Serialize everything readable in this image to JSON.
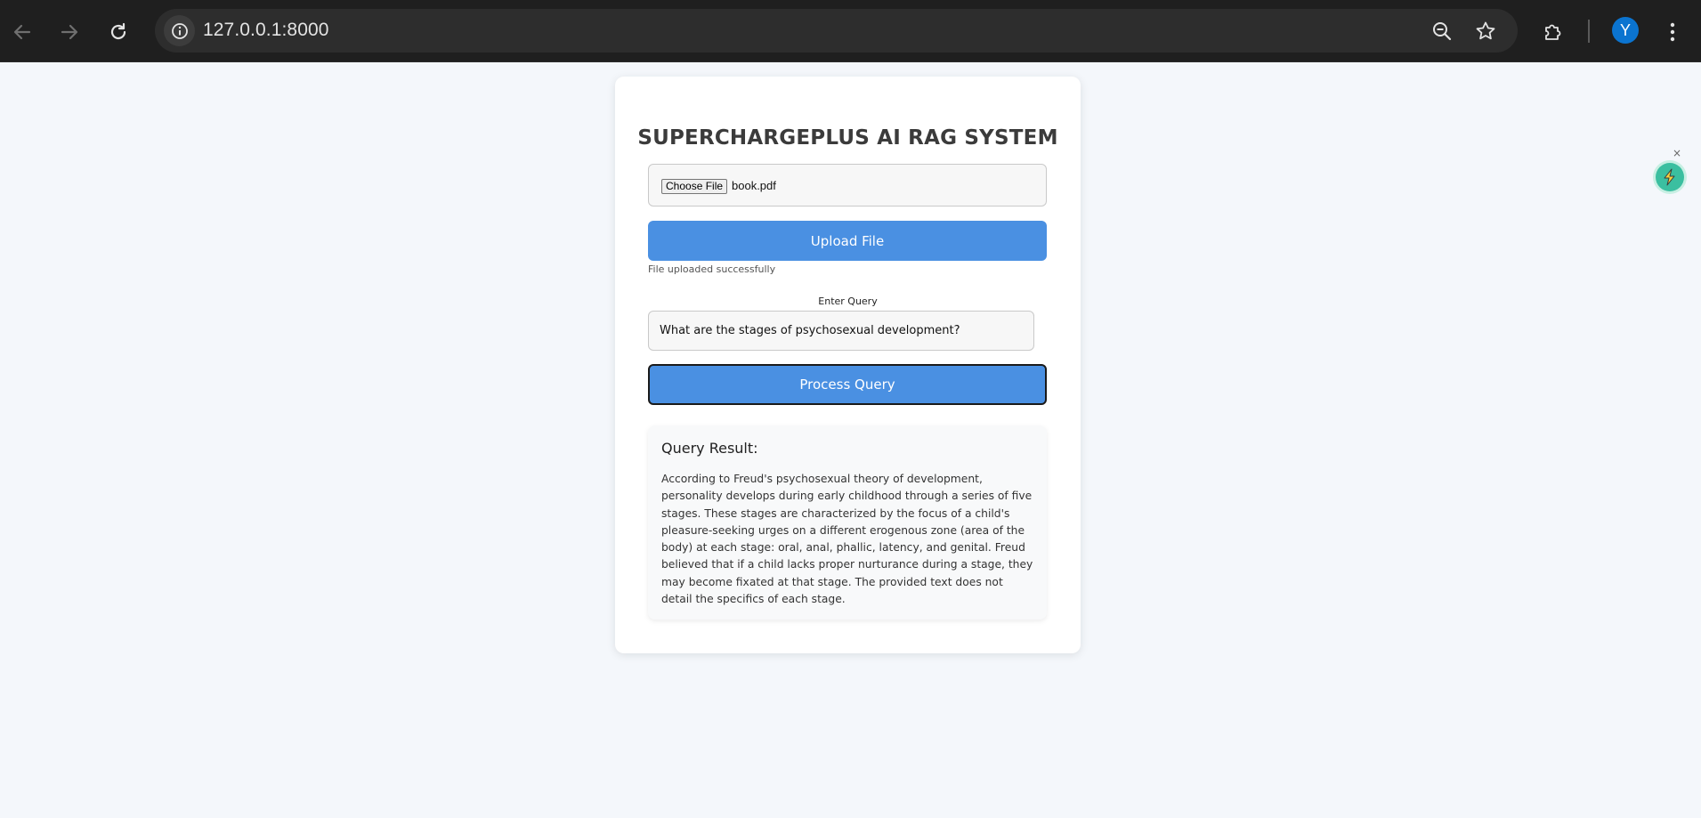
{
  "browser": {
    "url": "127.0.0.1:8000",
    "profile_initial": "Y",
    "icons": {
      "back": "arrow-back-icon",
      "forward": "arrow-forward-icon",
      "reload": "reload-icon",
      "site_info": "info-icon",
      "zoom": "zoom-out-icon",
      "bookmark": "star-icon",
      "extensions": "puzzle-icon",
      "menu": "kebab-menu-icon"
    }
  },
  "app": {
    "title": "SUPERCHARGEPLUS AI RAG SYSTEM",
    "file_input": {
      "button_label": "Choose File",
      "file_name": "book.pdf"
    },
    "upload_button_label": "Upload File",
    "upload_status": "File uploaded successfully",
    "query_label": "Enter Query",
    "query_value": "What are the stages of psychosexual development?",
    "process_button_label": "Process Query",
    "result": {
      "heading": "Query Result:",
      "text": "According to Freud's psychosexual theory of development, personality develops during early childhood through a series of five stages. These stages are characterized by the focus of a child's pleasure-seeking urges on a different erogenous zone (area of the body) at each stage: oral, anal, phallic, latency, and genital. Freud believed that if a child lacks proper nurturance during a stage, they may become fixated at that stage. The provided text does not detail the specifics of each stage."
    }
  },
  "floating_widget": {
    "close_glyph": "×",
    "icon": "lightning-bolt-icon",
    "accent": "#3bbfa0"
  },
  "colors": {
    "primary": "#4a90e2",
    "page_background": "#f4f7fb",
    "chrome_background": "#1f1f1f"
  }
}
